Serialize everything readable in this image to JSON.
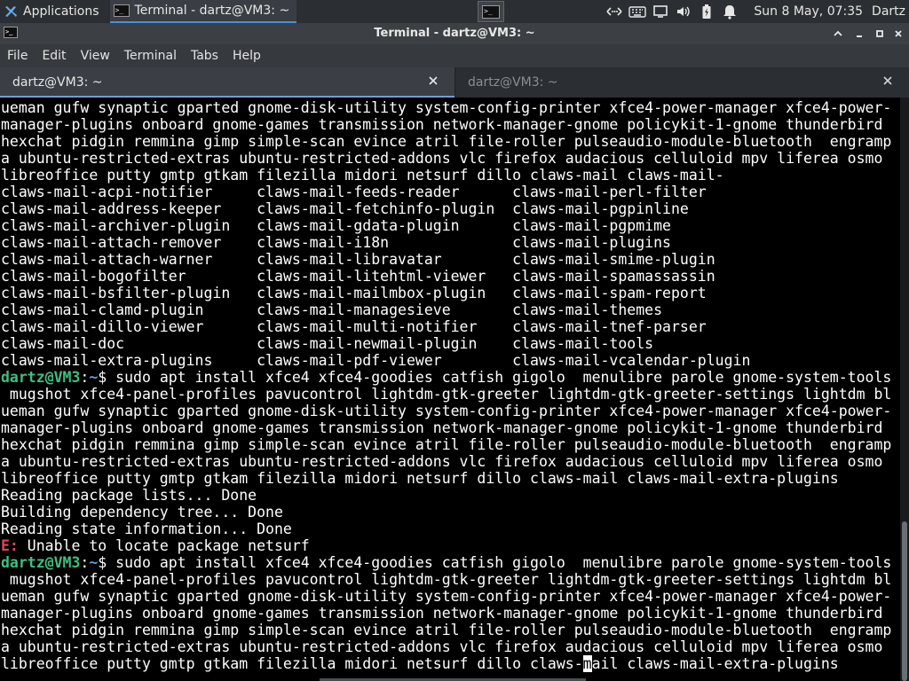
{
  "panel": {
    "applications_label": "Applications",
    "task_label": "Terminal - dartz@VM3: ~",
    "clock": "Sun  8 May, 07:35",
    "user": "Dartz",
    "workspace_glyph": ">_"
  },
  "window": {
    "title": "Terminal - dartz@VM3: ~"
  },
  "menu": [
    "File",
    "Edit",
    "View",
    "Terminal",
    "Tabs",
    "Help"
  ],
  "tabs": [
    {
      "label": "dartz@VM3: ~"
    },
    {
      "label": "dartz@VM3: ~"
    }
  ],
  "terminal": {
    "prompt_user": "dartz@VM3",
    "prompt_path": "~",
    "command_text": "sudo apt install xfce4 xfce4-goodies catfish gigolo  menulibre parole gnome-system-tools",
    "lines": [
      {
        "t": "plain",
        "text": "ueman gufw synaptic gparted gnome-disk-utility system-config-printer xfce4-power-manager xfce4-power-"
      },
      {
        "t": "plain",
        "text": "manager-plugins onboard gnome-games transmission network-manager-gnome policykit-1-gnome thunderbird"
      },
      {
        "t": "plain",
        "text": "hexchat pidgin remmina gimp simple-scan evince atril file-roller pulseaudio-module-bluetooth  engramp"
      },
      {
        "t": "plain",
        "text": "a ubuntu-restricted-extras ubuntu-restricted-addons vlc firefox audacious celluloid mpv liferea osmo"
      },
      {
        "t": "plain",
        "text": "libreoffice putty gmtp gtkam filezilla midori netsurf dillo claws-mail claws-mail-"
      },
      {
        "t": "plain",
        "text": "claws-mail-acpi-notifier     claws-mail-feeds-reader      claws-mail-perl-filter"
      },
      {
        "t": "plain",
        "text": "claws-mail-address-keeper    claws-mail-fetchinfo-plugin  claws-mail-pgpinline"
      },
      {
        "t": "plain",
        "text": "claws-mail-archiver-plugin   claws-mail-gdata-plugin      claws-mail-pgpmime"
      },
      {
        "t": "plain",
        "text": "claws-mail-attach-remover    claws-mail-i18n              claws-mail-plugins"
      },
      {
        "t": "plain",
        "text": "claws-mail-attach-warner     claws-mail-libravatar        claws-mail-smime-plugin"
      },
      {
        "t": "plain",
        "text": "claws-mail-bogofilter        claws-mail-litehtml-viewer   claws-mail-spamassassin"
      },
      {
        "t": "plain",
        "text": "claws-mail-bsfilter-plugin   claws-mail-mailmbox-plugin   claws-mail-spam-report"
      },
      {
        "t": "plain",
        "text": "claws-mail-clamd-plugin      claws-mail-managesieve       claws-mail-themes"
      },
      {
        "t": "plain",
        "text": "claws-mail-dillo-viewer      claws-mail-multi-notifier    claws-mail-tnef-parser"
      },
      {
        "t": "plain",
        "text": "claws-mail-doc               claws-mail-newmail-plugin    claws-mail-tools"
      },
      {
        "t": "plain",
        "text": "claws-mail-extra-plugins     claws-mail-pdf-viewer        claws-mail-vcalendar-plugin"
      },
      {
        "t": "prompt",
        "text": "$ sudo apt install xfce4 xfce4-goodies catfish gigolo  menulibre parole gnome-system-tools"
      },
      {
        "t": "plain",
        "text": " mugshot xfce4-panel-profiles pavucontrol lightdm-gtk-greeter lightdm-gtk-greeter-settings lightdm bl"
      },
      {
        "t": "plain",
        "text": "ueman gufw synaptic gparted gnome-disk-utility system-config-printer xfce4-power-manager xfce4-power-"
      },
      {
        "t": "plain",
        "text": "manager-plugins onboard gnome-games transmission network-manager-gnome policykit-1-gnome thunderbird"
      },
      {
        "t": "plain",
        "text": "hexchat pidgin remmina gimp simple-scan evince atril file-roller pulseaudio-module-bluetooth  engramp"
      },
      {
        "t": "plain",
        "text": "a ubuntu-restricted-extras ubuntu-restricted-addons vlc firefox audacious celluloid mpv liferea osmo"
      },
      {
        "t": "plain",
        "text": "libreoffice putty gmtp gtkam filezilla midori netsurf dillo claws-mail claws-mail-extra-plugins"
      },
      {
        "t": "plain",
        "text": "Reading package lists... Done"
      },
      {
        "t": "plain",
        "text": "Building dependency tree... Done"
      },
      {
        "t": "plain",
        "text": "Reading state information... Done"
      },
      {
        "t": "error",
        "tag": "E:",
        "text": " Unable to locate package netsurf"
      },
      {
        "t": "prompt",
        "text": "$ sudo apt install xfce4 xfce4-goodies catfish gigolo  menulibre parole gnome-system-tools"
      },
      {
        "t": "plain",
        "text": " mugshot xfce4-panel-profiles pavucontrol lightdm-gtk-greeter lightdm-gtk-greeter-settings lightdm bl"
      },
      {
        "t": "plain",
        "text": "ueman gufw synaptic gparted gnome-disk-utility system-config-printer xfce4-power-manager xfce4-power-"
      },
      {
        "t": "plain",
        "text": "manager-plugins onboard gnome-games transmission network-manager-gnome policykit-1-gnome thunderbird"
      },
      {
        "t": "plain",
        "text": "hexchat pidgin remmina gimp simple-scan evince atril file-roller pulseaudio-module-bluetooth  engramp"
      },
      {
        "t": "plain",
        "text": "a ubuntu-restricted-extras ubuntu-restricted-addons vlc firefox audacious celluloid mpv liferea osmo"
      },
      {
        "t": "cursor",
        "before": "libreoffice putty gmtp gtkam filezilla midori netsurf dillo claws-",
        "cursor": "m",
        "after": "ail claws-mail-extra-plugins"
      }
    ]
  },
  "colors": {
    "prompt_user": "#3fbf7f",
    "prompt_path": "#5f9fd8",
    "error": "#e0465b"
  },
  "icons": [
    "xfce-logo-icon",
    "terminal-icon",
    "workspace-icon",
    "network-icon",
    "keyboard-icon",
    "display-icon",
    "volume-icon",
    "battery-icon",
    "notification-bell-icon",
    "minimize-icon",
    "maximize-icon",
    "close-icon"
  ]
}
